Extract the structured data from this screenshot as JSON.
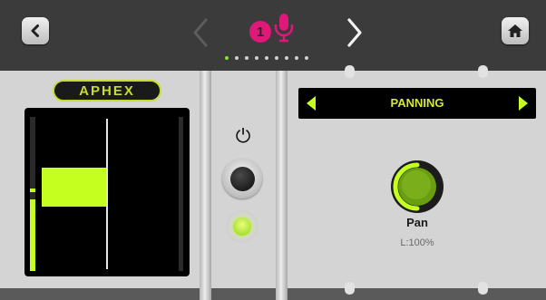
{
  "topbar": {
    "channel_number": "1",
    "page_count": 9,
    "active_page": 1
  },
  "plugin": {
    "brand": "APHEX"
  },
  "power": {
    "symbol": "⏻"
  },
  "selector": {
    "label": "PANNING"
  },
  "knob": {
    "label": "Pan",
    "value": "L:100%",
    "level": 1.0
  },
  "colors": {
    "accent_green": "#c4ff1f",
    "record_magenta": "#e0187a"
  }
}
